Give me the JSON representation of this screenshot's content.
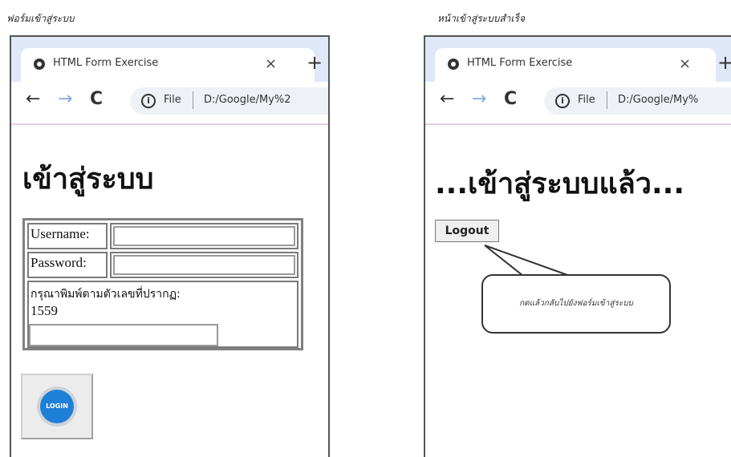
{
  "left": {
    "caption": "ฟอร์มเข้าสู่ระบบ",
    "tab_title": "HTML Form Exercise",
    "close_icon": "×",
    "new_tab_icon": "+",
    "back_icon": "←",
    "forward_icon": "→",
    "reload_icon": "C",
    "info_icon": "i",
    "file_label": "File",
    "url": "D:/Google/My%2",
    "heading": "เข้าสู่ระบบ",
    "username_label": "Username:",
    "username_value": "",
    "password_label": "Password:",
    "password_value": "",
    "captcha_prompt": "กรุณาพิมพ์ตามตัวเลขที่ปรากฏ:",
    "captcha_code": "1559",
    "captcha_value": "",
    "login_label": "LOGIN"
  },
  "right": {
    "caption": "หน้าเข้าสู่ระบบสำเร็จ",
    "tab_title": "HTML Form Exercise",
    "close_icon": "×",
    "new_tab_icon": "+",
    "back_icon": "←",
    "forward_icon": "→",
    "reload_icon": "C",
    "info_icon": "i",
    "file_label": "File",
    "url": "D:/Google/My%",
    "heading": "...เข้าสู่ระบบแล้ว...",
    "logout_label": "Logout",
    "callout_text": "กดแล้วกลับไปยังฟอร์มเข้าสู่ระบบ"
  }
}
